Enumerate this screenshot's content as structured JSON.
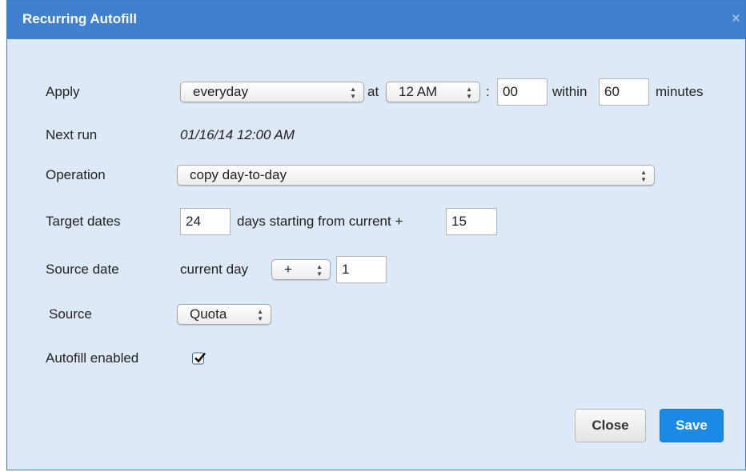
{
  "dialog": {
    "title": "Recurring Autofill",
    "close_icon": "×"
  },
  "apply": {
    "label": "Apply",
    "frequency": "everyday",
    "at_text": "at",
    "hour": "12 AM",
    "colon": ":",
    "minute": "00",
    "within_text": "within",
    "within_value": "60",
    "minutes_text": "minutes"
  },
  "next_run": {
    "label": "Next run",
    "value": "01/16/14 12:00 AM"
  },
  "operation": {
    "label": "Operation",
    "value": "copy day-to-day"
  },
  "target_dates": {
    "label": "Target dates",
    "days": "24",
    "mid_text": "days starting from current +",
    "offset": "15"
  },
  "source_date": {
    "label": "Source date",
    "prefix": "current day",
    "sign": "+",
    "offset": "1"
  },
  "source": {
    "label": "Source",
    "value": "Quota"
  },
  "autofill_enabled": {
    "label": "Autofill enabled",
    "checked": true
  },
  "buttons": {
    "close_label": "Close",
    "save_label": "Save"
  },
  "colors": {
    "titlebar": "#3f80cf",
    "body": "#dde9f6",
    "save": "#1a8ae6"
  },
  "select_arrow_icon": "⇕"
}
